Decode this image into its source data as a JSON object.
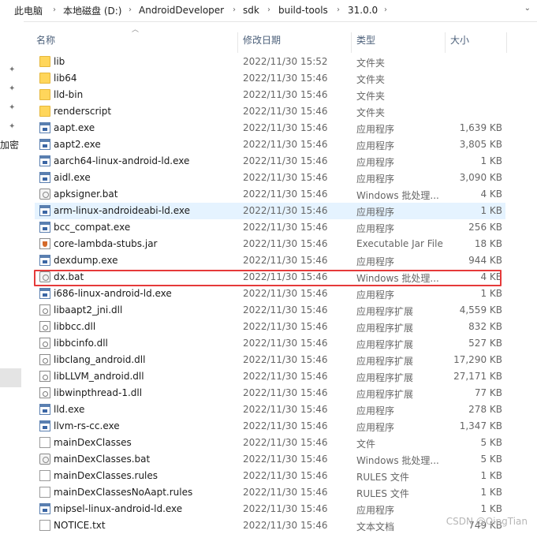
{
  "breadcrumb": [
    "此电脑",
    "本地磁盘 (D:)",
    "AndroidDeveloper",
    "sdk",
    "build-tools",
    "31.0.0"
  ],
  "columns": {
    "name": "名称",
    "date": "修改日期",
    "type": "类型",
    "size": "大小"
  },
  "sidebar_fragment": "加密",
  "watermark": "CSDN @QingTian",
  "files": [
    {
      "name": "lib",
      "date": "2022/11/30 15:52",
      "type": "文件夹",
      "size": "",
      "icon": "folder"
    },
    {
      "name": "lib64",
      "date": "2022/11/30 15:46",
      "type": "文件夹",
      "size": "",
      "icon": "folder"
    },
    {
      "name": "lld-bin",
      "date": "2022/11/30 15:46",
      "type": "文件夹",
      "size": "",
      "icon": "folder"
    },
    {
      "name": "renderscript",
      "date": "2022/11/30 15:46",
      "type": "文件夹",
      "size": "",
      "icon": "folder"
    },
    {
      "name": "aapt.exe",
      "date": "2022/11/30 15:46",
      "type": "应用程序",
      "size": "1,639 KB",
      "icon": "exe"
    },
    {
      "name": "aapt2.exe",
      "date": "2022/11/30 15:46",
      "type": "应用程序",
      "size": "3,805 KB",
      "icon": "exe"
    },
    {
      "name": "aarch64-linux-android-ld.exe",
      "date": "2022/11/30 15:46",
      "type": "应用程序",
      "size": "1 KB",
      "icon": "exe"
    },
    {
      "name": "aidl.exe",
      "date": "2022/11/30 15:46",
      "type": "应用程序",
      "size": "3,090 KB",
      "icon": "exe"
    },
    {
      "name": "apksigner.bat",
      "date": "2022/11/30 15:46",
      "type": "Windows 批处理...",
      "size": "4 KB",
      "icon": "bat"
    },
    {
      "name": "arm-linux-androideabi-ld.exe",
      "date": "2022/11/30 15:46",
      "type": "应用程序",
      "size": "1 KB",
      "icon": "exe"
    },
    {
      "name": "bcc_compat.exe",
      "date": "2022/11/30 15:46",
      "type": "应用程序",
      "size": "256 KB",
      "icon": "exe"
    },
    {
      "name": "core-lambda-stubs.jar",
      "date": "2022/11/30 15:46",
      "type": "Executable Jar File",
      "size": "18 KB",
      "icon": "jar"
    },
    {
      "name": "dexdump.exe",
      "date": "2022/11/30 15:46",
      "type": "应用程序",
      "size": "944 KB",
      "icon": "exe"
    },
    {
      "name": "dx.bat",
      "date": "2022/11/30 15:46",
      "type": "Windows 批处理...",
      "size": "4 KB",
      "icon": "bat"
    },
    {
      "name": "i686-linux-android-ld.exe",
      "date": "2022/11/30 15:46",
      "type": "应用程序",
      "size": "1 KB",
      "icon": "exe"
    },
    {
      "name": "libaapt2_jni.dll",
      "date": "2022/11/30 15:46",
      "type": "应用程序扩展",
      "size": "4,559 KB",
      "icon": "dll"
    },
    {
      "name": "libbcc.dll",
      "date": "2022/11/30 15:46",
      "type": "应用程序扩展",
      "size": "832 KB",
      "icon": "dll"
    },
    {
      "name": "libbcinfo.dll",
      "date": "2022/11/30 15:46",
      "type": "应用程序扩展",
      "size": "527 KB",
      "icon": "dll"
    },
    {
      "name": "libclang_android.dll",
      "date": "2022/11/30 15:46",
      "type": "应用程序扩展",
      "size": "17,290 KB",
      "icon": "dll"
    },
    {
      "name": "libLLVM_android.dll",
      "date": "2022/11/30 15:46",
      "type": "应用程序扩展",
      "size": "27,171 KB",
      "icon": "dll"
    },
    {
      "name": "libwinpthread-1.dll",
      "date": "2022/11/30 15:46",
      "type": "应用程序扩展",
      "size": "77 KB",
      "icon": "dll"
    },
    {
      "name": "lld.exe",
      "date": "2022/11/30 15:46",
      "type": "应用程序",
      "size": "278 KB",
      "icon": "exe"
    },
    {
      "name": "llvm-rs-cc.exe",
      "date": "2022/11/30 15:46",
      "type": "应用程序",
      "size": "1,347 KB",
      "icon": "exe"
    },
    {
      "name": "mainDexClasses",
      "date": "2022/11/30 15:46",
      "type": "文件",
      "size": "5 KB",
      "icon": "doc"
    },
    {
      "name": "mainDexClasses.bat",
      "date": "2022/11/30 15:46",
      "type": "Windows 批处理...",
      "size": "5 KB",
      "icon": "bat"
    },
    {
      "name": "mainDexClasses.rules",
      "date": "2022/11/30 15:46",
      "type": "RULES 文件",
      "size": "1 KB",
      "icon": "doc"
    },
    {
      "name": "mainDexClassesNoAapt.rules",
      "date": "2022/11/30 15:46",
      "type": "RULES 文件",
      "size": "1 KB",
      "icon": "doc"
    },
    {
      "name": "mipsel-linux-android-ld.exe",
      "date": "2022/11/30 15:46",
      "type": "应用程序",
      "size": "1 KB",
      "icon": "exe"
    },
    {
      "name": "NOTICE.txt",
      "date": "2022/11/30 15:46",
      "type": "文本文档",
      "size": "749 KB",
      "icon": "doc"
    }
  ]
}
